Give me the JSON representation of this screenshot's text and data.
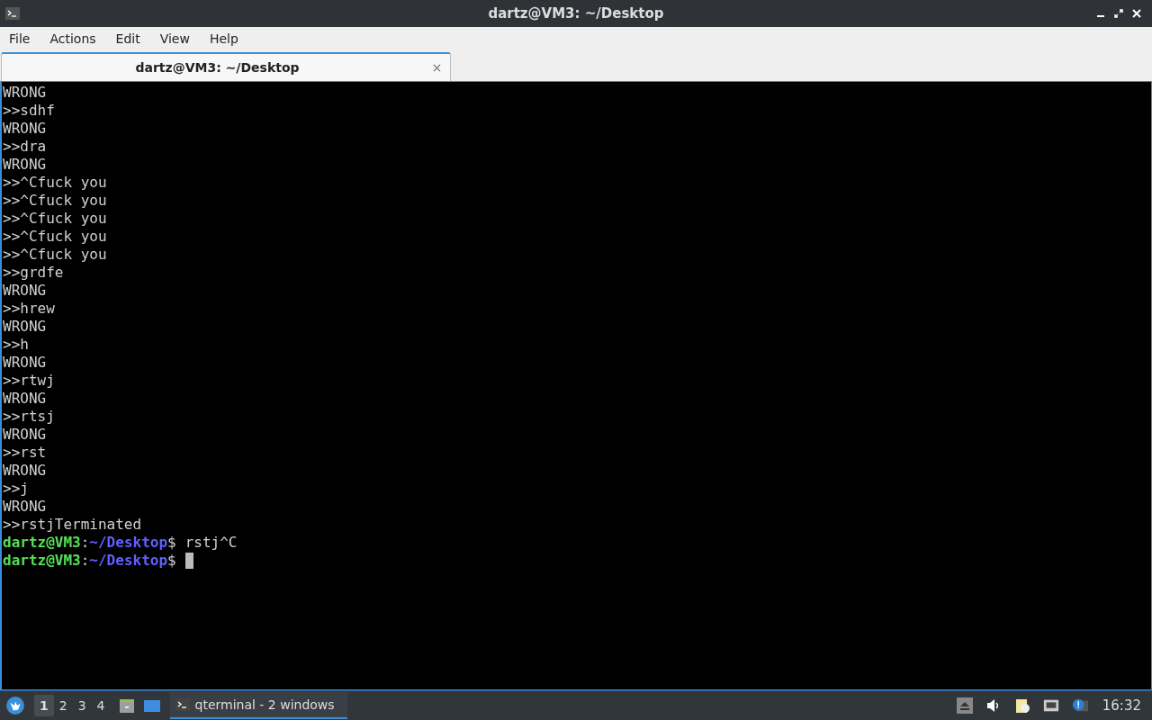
{
  "window": {
    "title": "dartz@VM3: ~/Desktop"
  },
  "menu": [
    "File",
    "Actions",
    "Edit",
    "View",
    "Help"
  ],
  "tabs": [
    {
      "label": "dartz@VM3: ~/Desktop",
      "selected": true
    }
  ],
  "terminal": {
    "lines": [
      {
        "kind": "output",
        "text": "WRONG"
      },
      {
        "kind": "output",
        "text": ">>sdhf"
      },
      {
        "kind": "output",
        "text": "WRONG"
      },
      {
        "kind": "output",
        "text": ">>dra"
      },
      {
        "kind": "output",
        "text": "WRONG"
      },
      {
        "kind": "output",
        "text": ">>^Cfuck you"
      },
      {
        "kind": "output",
        "text": ">>^Cfuck you"
      },
      {
        "kind": "output",
        "text": ">>^Cfuck you"
      },
      {
        "kind": "output",
        "text": ">>^Cfuck you"
      },
      {
        "kind": "output",
        "text": ">>^Cfuck you"
      },
      {
        "kind": "output",
        "text": ">>grdfe"
      },
      {
        "kind": "output",
        "text": "WRONG"
      },
      {
        "kind": "output",
        "text": ">>hrew"
      },
      {
        "kind": "output",
        "text": "WRONG"
      },
      {
        "kind": "output",
        "text": ">>h"
      },
      {
        "kind": "output",
        "text": "WRONG"
      },
      {
        "kind": "output",
        "text": ">>rtwj"
      },
      {
        "kind": "output",
        "text": "WRONG"
      },
      {
        "kind": "output",
        "text": ">>rtsj"
      },
      {
        "kind": "output",
        "text": "WRONG"
      },
      {
        "kind": "output",
        "text": ">>rst"
      },
      {
        "kind": "output",
        "text": "WRONG"
      },
      {
        "kind": "output",
        "text": ">>j"
      },
      {
        "kind": "output",
        "text": "WRONG"
      },
      {
        "kind": "output",
        "text": ">>rstjTerminated"
      },
      {
        "kind": "prompt",
        "user": "dartz@VM3",
        "sep": ":",
        "path": "~/Desktop",
        "dollar": "$",
        "command": "rstj^C",
        "cursor": false
      },
      {
        "kind": "prompt",
        "user": "dartz@VM3",
        "sep": ":",
        "path": "~/Desktop",
        "dollar": "$",
        "cursor": true
      }
    ]
  },
  "taskbar": {
    "workspaces": [
      {
        "label": "1",
        "selected": true
      },
      {
        "label": "2",
        "selected": false
      },
      {
        "label": "3",
        "selected": false
      },
      {
        "label": "4",
        "selected": false
      }
    ],
    "tasks": [
      {
        "label": "qterminal - 2 windows",
        "selected": true
      }
    ],
    "clock": "16:32"
  }
}
